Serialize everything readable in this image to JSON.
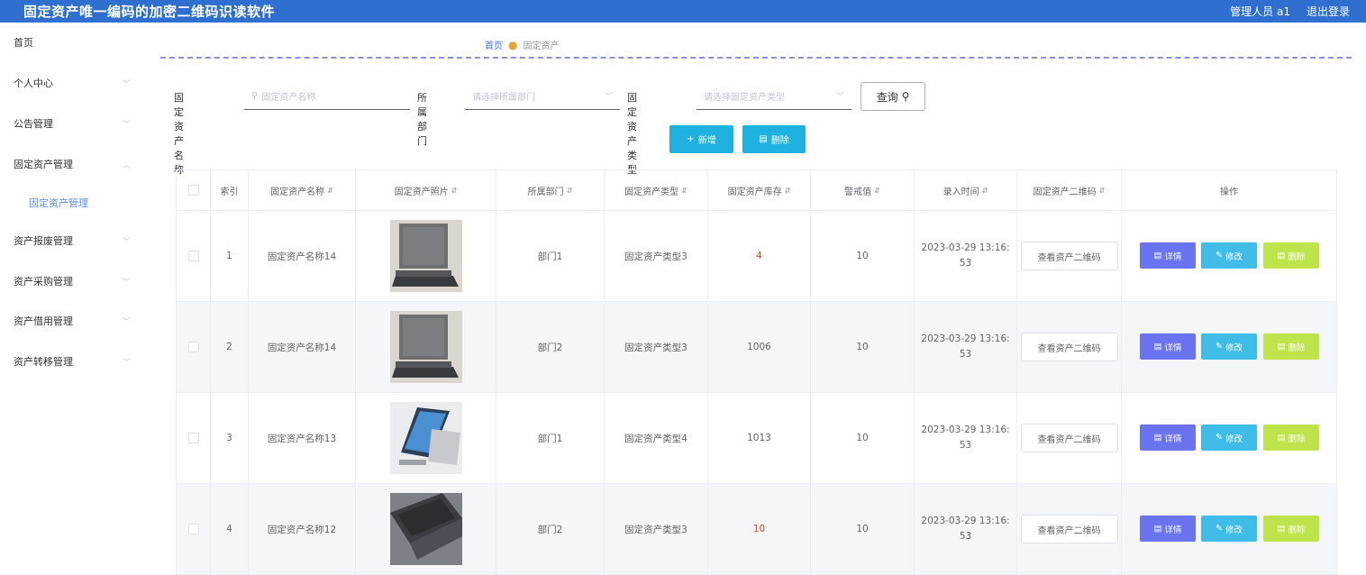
{
  "app": {
    "title": "固定资产唯一编码的加密二维码识读软件",
    "user": "管理人员 a1",
    "logout": "退出登录"
  },
  "sidebar": {
    "items": [
      {
        "label": "首页"
      },
      {
        "label": "个人中心"
      },
      {
        "label": "公告管理"
      },
      {
        "label": "固定资产管理"
      },
      {
        "label": "资产报废管理"
      },
      {
        "label": "资产采购管理"
      },
      {
        "label": "资产借用管理"
      },
      {
        "label": "资产转移管理"
      }
    ],
    "sub_item": "固定资产管理"
  },
  "breadcrumb": {
    "home": "首页",
    "current": "固定资产"
  },
  "search": {
    "name_label": "固定资产名称",
    "name_placeholder": "固定资产名称",
    "dept_label": "所属部门",
    "dept_placeholder": "请选择所属部门",
    "type_label": "固定资产类型",
    "type_placeholder": "请选择固定资产类型",
    "query": "查询"
  },
  "toolbar": {
    "add": "新增",
    "delete": "删除"
  },
  "table": {
    "headers": [
      "索引",
      "固定资产名称",
      "固定资产照片",
      "所属部门",
      "固定资产类型",
      "固定资产库存",
      "警戒值",
      "录入时间",
      "固定资产二维码",
      "操作"
    ],
    "qr_label": "查看资产二维码",
    "actions": {
      "detail": "详情",
      "edit": "修改",
      "delete": "删除"
    },
    "rows": [
      {
        "index": "1",
        "name": "固定资产名称14",
        "dept": "部门1",
        "type": "固定资产类型3",
        "stock": "4",
        "stock_alert": true,
        "threshold": "10",
        "time_a": "2023-03-29 13:16:",
        "time_b": "53",
        "photo": "laptop-open"
      },
      {
        "index": "2",
        "name": "固定资产名称14",
        "dept": "部门2",
        "type": "固定资产类型3",
        "stock": "1006",
        "stock_alert": false,
        "threshold": "10",
        "time_a": "2023-03-29 13:16:",
        "time_b": "53",
        "photo": "laptop-open"
      },
      {
        "index": "3",
        "name": "固定资产名称13",
        "dept": "部门1",
        "type": "固定资产类型4",
        "stock": "1013",
        "stock_alert": false,
        "threshold": "10",
        "time_a": "2023-03-29 13:16:",
        "time_b": "53",
        "photo": "tablet-stand"
      },
      {
        "index": "4",
        "name": "固定资产名称12",
        "dept": "部门2",
        "type": "固定资产类型3",
        "stock": "10",
        "stock_alert": true,
        "threshold": "10",
        "time_a": "2023-03-29 13:16:",
        "time_b": "53",
        "photo": "laptop-dark"
      }
    ]
  },
  "colors": {
    "topbar": "#2f6fd0",
    "primary_btn": "#1fb2e0",
    "detail": "#6b74f0",
    "edit": "#3fbde8",
    "delete": "#bfe34a",
    "alert": "#e2401c"
  }
}
